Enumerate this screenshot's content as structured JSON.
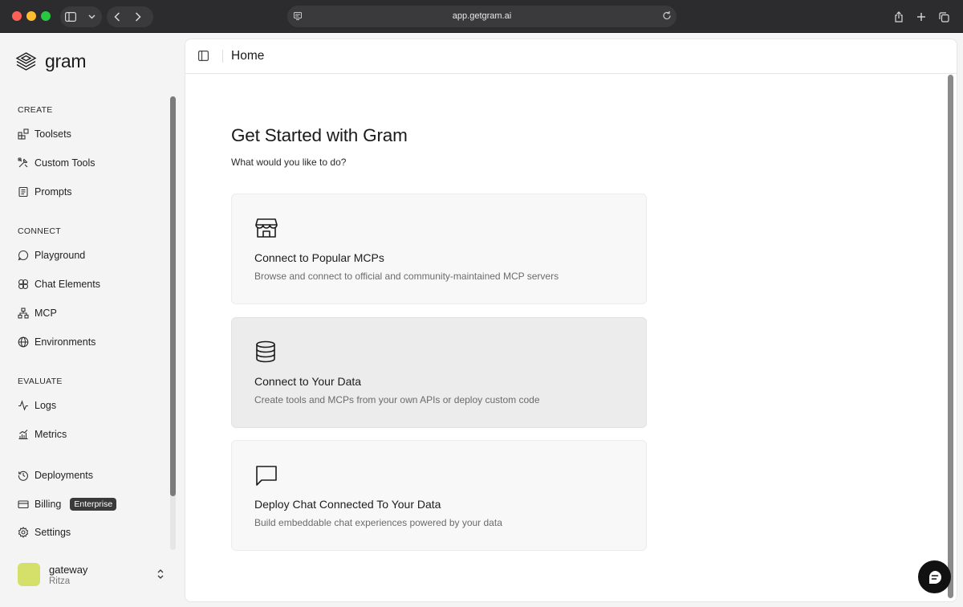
{
  "browser": {
    "url": "app.getgram.ai"
  },
  "brand": {
    "name": "gram"
  },
  "sidebar": {
    "sections": [
      {
        "label": "CREATE",
        "items": [
          {
            "label": "Toolsets",
            "icon": "toolsets-icon"
          },
          {
            "label": "Custom Tools",
            "icon": "tools-icon"
          },
          {
            "label": "Prompts",
            "icon": "prompts-icon"
          }
        ]
      },
      {
        "label": "CONNECT",
        "items": [
          {
            "label": "Playground",
            "icon": "chat-bubble-icon"
          },
          {
            "label": "Chat Elements",
            "icon": "chat-elements-icon"
          },
          {
            "label": "MCP",
            "icon": "network-icon"
          },
          {
            "label": "Environments",
            "icon": "globe-icon"
          }
        ]
      },
      {
        "label": "EVALUATE",
        "items": [
          {
            "label": "Logs",
            "icon": "activity-icon"
          },
          {
            "label": "Metrics",
            "icon": "chart-icon"
          }
        ]
      }
    ],
    "footer_items": [
      {
        "label": "Deployments",
        "icon": "history-icon"
      },
      {
        "label": "Billing",
        "icon": "credit-card-icon",
        "badge": "Enterprise"
      },
      {
        "label": "Settings",
        "icon": "gear-icon"
      }
    ],
    "org": {
      "name": "gateway",
      "user": "Ritza",
      "avatar_color": "#d5e06b"
    }
  },
  "header": {
    "title": "Home"
  },
  "main": {
    "title": "Get Started with Gram",
    "subtitle": "What would you like to do?",
    "cards": [
      {
        "title": "Connect to Popular MCPs",
        "description": "Browse and connect to official and community-maintained MCP servers",
        "icon": "store-icon"
      },
      {
        "title": "Connect to Your Data",
        "description": "Create tools and MCPs from your own APIs or deploy custom code",
        "icon": "database-icon"
      },
      {
        "title": "Deploy Chat Connected To Your Data",
        "description": "Build embeddable chat experiences powered by your data",
        "icon": "message-square-icon"
      }
    ]
  },
  "colors": {
    "accent_dark": "#111111",
    "badge_bg": "#3a3a3a",
    "active_card_bg": "#ececec"
  }
}
